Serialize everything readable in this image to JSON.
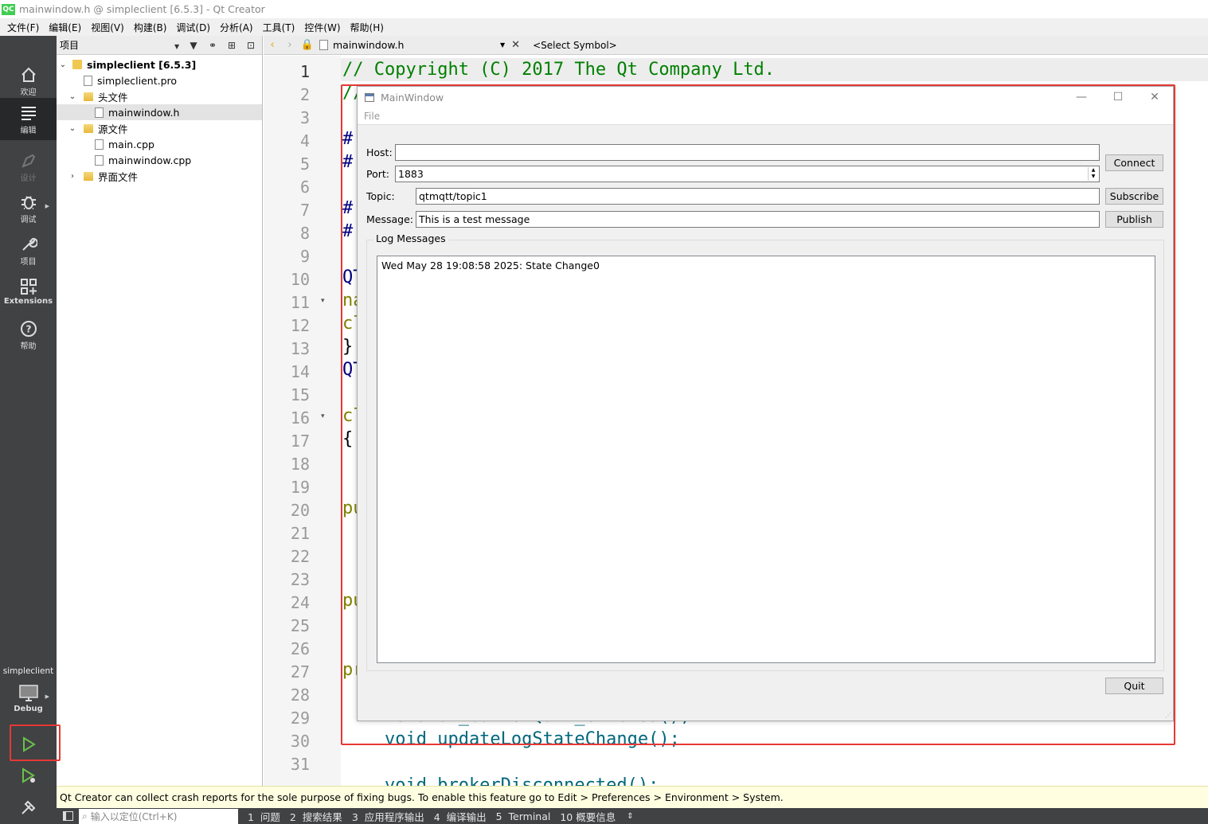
{
  "window_title": "mainwindow.h @ simpleclient [6.5.3] - Qt Creator",
  "logo_text": "QC",
  "menu": [
    "文件(F)",
    "编辑(E)",
    "视图(V)",
    "构建(B)",
    "调试(D)",
    "分析(A)",
    "工具(T)",
    "控件(W)",
    "帮助(H)"
  ],
  "sidebar": {
    "modes": [
      {
        "label": "欢迎",
        "icon": "home-icon"
      },
      {
        "label": "编辑",
        "icon": "edit-icon"
      },
      {
        "label": "设计",
        "icon": "design-icon"
      },
      {
        "label": "调试",
        "icon": "debug-bug-icon"
      },
      {
        "label": "项目",
        "icon": "wrench-icon"
      },
      {
        "label": "Extensions",
        "icon": "extensions-icon"
      },
      {
        "label": "帮助",
        "icon": "help-icon"
      }
    ],
    "target_project": "simpleclient",
    "target_config": "Debug"
  },
  "project_panel": {
    "combo_label": "项目",
    "tree": [
      {
        "label": "simpleclient",
        "suffix": " [6.5.3]",
        "bold": true
      },
      {
        "label": "simpleclient.pro"
      },
      {
        "label": "头文件"
      },
      {
        "label": "mainwindow.h"
      },
      {
        "label": "源文件"
      },
      {
        "label": "main.cpp"
      },
      {
        "label": "mainwindow.cpp"
      },
      {
        "label": "界面文件"
      }
    ]
  },
  "editor": {
    "file_name": "mainwindow.h",
    "symbol": "<Select Symbol>",
    "line_numbers": [
      "1",
      "2",
      "3",
      "4",
      "5",
      "6",
      "7",
      "8",
      "9",
      "10",
      "11",
      "12",
      "13",
      "14",
      "15",
      "16",
      "17",
      "18",
      "19",
      "20",
      "21",
      "22",
      "23",
      "24",
      "25",
      "26",
      "27",
      "28",
      "29",
      "30",
      "31"
    ],
    "code_lines": [
      "// Copyright (C) 2017 The Qt Company Ltd.",
      "//",
      "#",
      "#",
      "#",
      "#",
      "QT",
      "na",
      "cl",
      "}",
      "QT",
      "cl",
      "{",
      "pu",
      "pu",
      "pr",
      "    void on_buttonQuit_clicked();",
      "    void updateLogStateChange();",
      "    void brokerDisconnected();"
    ]
  },
  "app_window": {
    "title": "MainWindow",
    "menu_file": "File",
    "host_label": "Host:",
    "host_value": "",
    "port_label": "Port:",
    "port_value": "1883",
    "topic_label": "Topic:",
    "topic_value": "qtmqtt/topic1",
    "message_label": "Message:",
    "message_value": "This is a test message",
    "connect_btn": "Connect",
    "subscribe_btn": "Subscribe",
    "publish_btn": "Publish",
    "log_group": "Log Messages",
    "log_text": "Wed May 28 19:08:58 2025: State Change0",
    "quit_btn": "Quit"
  },
  "info_bar": "Qt Creator can collect crash reports for the sole purpose of fixing bugs. To enable this feature go to Edit > Preferences > Environment > System.",
  "bottom_bar": {
    "locator_placeholder": "输入以定位(Ctrl+K)",
    "tabs": [
      "1  问题",
      "2  搜索结果",
      "3  应用程序输出",
      "4  编译输出",
      "5  Terminal",
      "10 概要信息"
    ]
  },
  "colors": {
    "highlight_box": "#e53935",
    "sidebar_bg": "#404244",
    "comment": "#008000"
  }
}
